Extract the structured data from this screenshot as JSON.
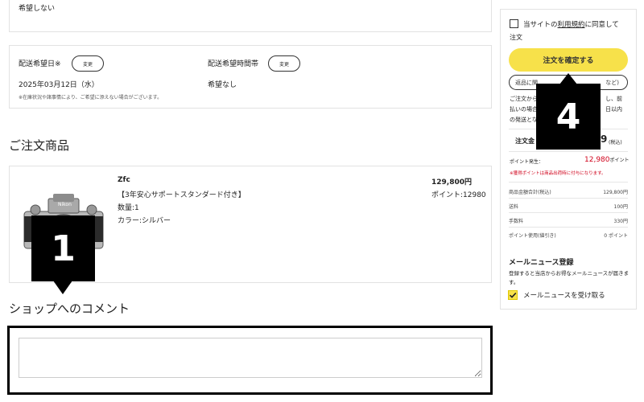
{
  "top_box": {
    "value": "希望しない"
  },
  "delivery": {
    "date_label": "配送希望日※",
    "date_change": "変更",
    "date_value": "2025年03月12日（水）",
    "time_label": "配送希望時間帯",
    "time_change": "変更",
    "time_value": "希望なし",
    "note": "※在庫状況や諸事情により、ご希望に添えない場合がございます。"
  },
  "order_items": {
    "title": "ご注文商品",
    "product": {
      "name": "Zfc",
      "plan": "【3年安心サポートスタンダード付き】",
      "quantity": "数量:1",
      "color": "カラー:シルバー",
      "price": "129,800円",
      "points": "ポイント:12980",
      "camera_brand": "Nikon"
    }
  },
  "comment": {
    "title": "ショップへのコメント",
    "value": ""
  },
  "markers": {
    "m1": "1",
    "m4": "4"
  },
  "sidebar": {
    "terms_prefix": "当サイトの",
    "terms_link": "利用規約",
    "terms_suffix": "に同意して",
    "terms_line2": "注文",
    "confirm_button": "注文を確定する",
    "return_button_left": "返品に関",
    "return_button_right": "など)",
    "notice_line1": "ご注文から",
    "notice_line1_right": "し、前",
    "notice_line2": "払いの場合",
    "notice_line2_right": "日以内",
    "notice_line3": "の発送とな",
    "order_total_label": "注文金",
    "order_total_right": "9",
    "order_total_tax": "(税込)",
    "points_label": "ポイント発生：",
    "points_value": "12,980",
    "points_unit": "ポイント",
    "points_note": "※獲得ポイントは商品出荷時に付与になります。",
    "rows": [
      {
        "label": "商品金額合計(税込)",
        "value": "129,800円"
      },
      {
        "label": "送料",
        "value": "100円"
      },
      {
        "label": "手数料",
        "value": "330円"
      },
      {
        "label": "ポイント使用(値引き)",
        "value": "0 ポイント"
      }
    ],
    "mail_title": "メールニュース登録",
    "mail_desc": "登録すると当店からお得なメールニュースが届きます。",
    "mail_checkbox_label": "メールニュースを受け取る"
  },
  "colors": {
    "accent_yellow": "#f7e14a",
    "marker_black": "#000000",
    "points_red": "#d0021b"
  }
}
